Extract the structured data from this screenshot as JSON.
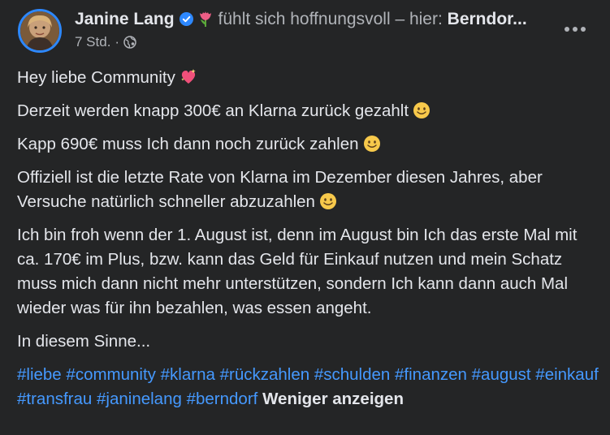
{
  "post": {
    "author": "Janine Lang",
    "feeling_text": "fühlt sich hoffnungsvoll – hier:",
    "place": "Berndor...",
    "time": "7 Std.",
    "separator": "·"
  },
  "icons": {
    "verified": "verified-badge-icon",
    "feeling": "tulip-icon",
    "audience": "globe-icon",
    "more": "more-options-icon",
    "sparkle_heart": "sparkling-heart-emoji",
    "smile": "smiling-face-emoji"
  },
  "colors": {
    "accent": "#2d88ff",
    "hashtag": "#4599ff",
    "background": "#242526"
  },
  "content": {
    "p1": "Hey liebe Community",
    "p2": "Derzeit werden knapp 300€ an Klarna zurück gezahlt",
    "p3": "Kapp 690€ muss Ich dann noch zurück zahlen",
    "p4": "Offiziell ist die letzte Rate von Klarna im Dezember diesen Jahres, aber Versuche natürlich schneller abzuzahlen",
    "p5": "Ich bin froh wenn der 1. August ist, denn im August bin Ich das erste Mal mit ca. 170€ im Plus, bzw. kann das Geld für Einkauf nutzen und mein Schatz muss mich dann nicht mehr unterstützen, sondern Ich kann dann auch Mal wieder was für ihn bezahlen, was essen angeht.",
    "p6": "In diesem Sinne...",
    "hashtags": [
      "#liebe",
      "#community",
      "#klarna",
      "#rückzahlen",
      "#schulden",
      "#finanzen",
      "#august",
      "#einkauf",
      "#transfrau",
      "#janinelang",
      "#berndorf"
    ],
    "show_less": "Weniger anzeigen"
  }
}
